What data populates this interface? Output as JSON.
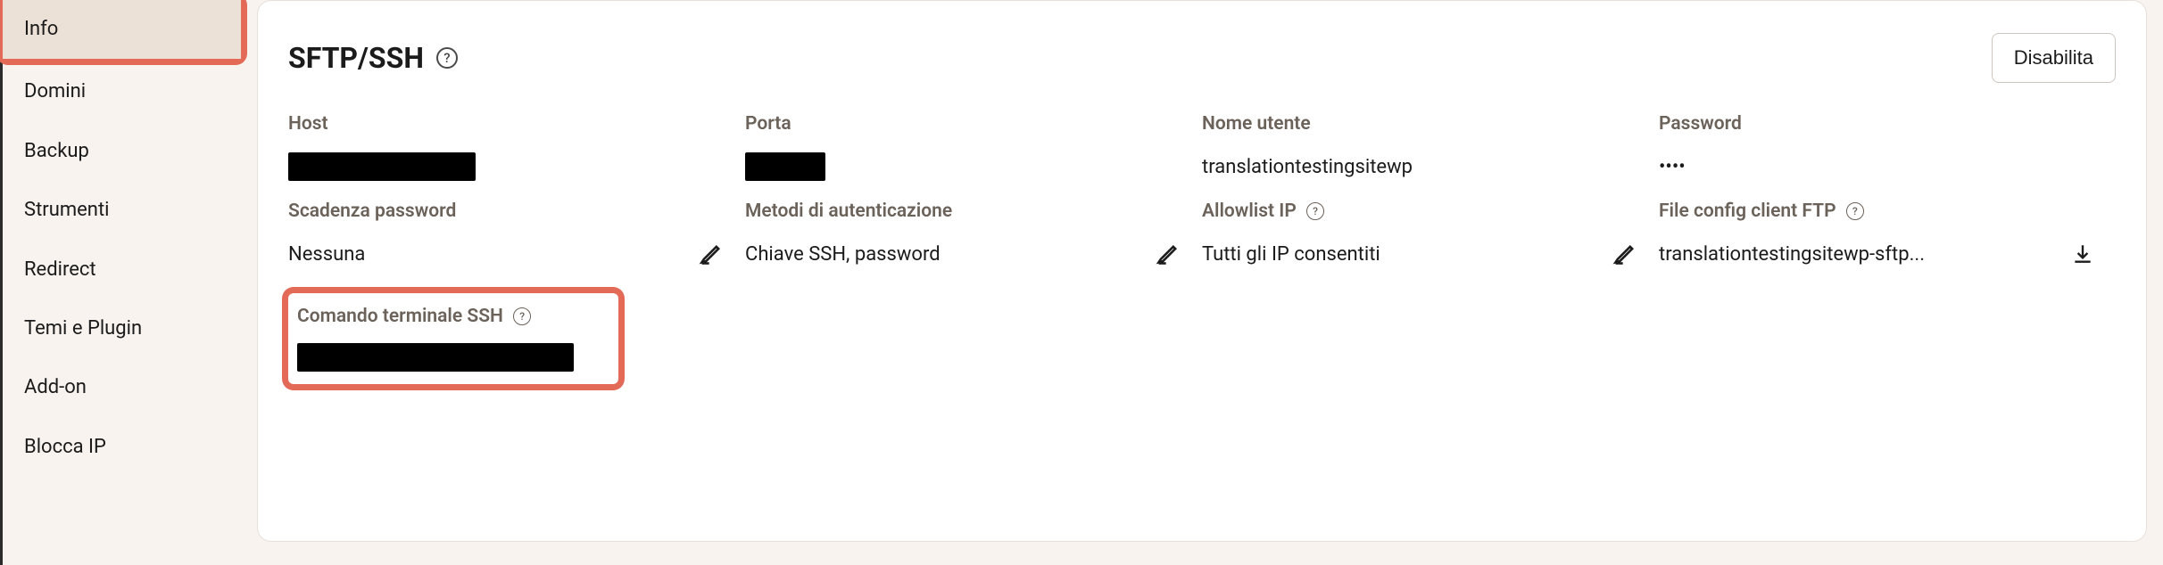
{
  "sidebar": {
    "items": [
      {
        "label": "Info"
      },
      {
        "label": "Domini"
      },
      {
        "label": "Backup"
      },
      {
        "label": "Strumenti"
      },
      {
        "label": "Redirect"
      },
      {
        "label": "Temi e Plugin"
      },
      {
        "label": "Add-on"
      },
      {
        "label": "Blocca IP"
      }
    ]
  },
  "panel": {
    "title": "SFTP/SSH",
    "disable_btn": "Disabilita",
    "fields": {
      "host_label": "Host",
      "port_label": "Porta",
      "user_label": "Nome utente",
      "user_value": "translationtestingsitewp",
      "password_label": "Password",
      "password_value": "••••",
      "pass_expiry_label": "Scadenza password",
      "pass_expiry_value": "Nessuna",
      "auth_methods_label": "Metodi di autenticazione",
      "auth_methods_value": "Chiave SSH, password",
      "allowlist_label": "Allowlist IP",
      "allowlist_value": "Tutti gli IP consentiti",
      "ftp_config_label": "File config client FTP",
      "ftp_config_value": "translationtestingsitewp-sftp...",
      "ssh_cmd_label": "Comando terminale SSH"
    }
  }
}
